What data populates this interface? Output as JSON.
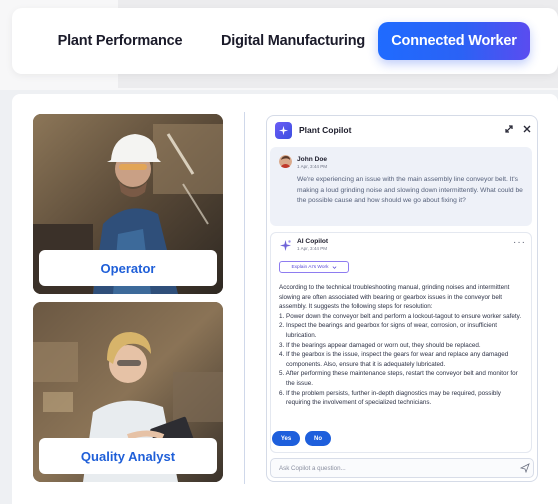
{
  "tabs": [
    {
      "label": "Plant Performance"
    },
    {
      "label": "Digital Manufacturing"
    },
    {
      "label": "Connected Worker",
      "active": true
    }
  ],
  "cards": [
    {
      "label": "Operator"
    },
    {
      "label": "Quality Analyst"
    }
  ],
  "copilot": {
    "title": "Plant Copilot",
    "user": {
      "name": "John Doe",
      "time": "1 Apr, 3:44 PM",
      "message": "We're experiencing an issue with the main assembly line conveyor belt. It's making a loud grinding noise and slowing down intermittently. What could be the possible cause and how should we go about fixing it?"
    },
    "ai": {
      "name": "AI Copilot",
      "time": "1 Apr, 3:44 PM",
      "more": "···",
      "explain_label": "Explain AI's Work",
      "intro": "According to the technical troubleshooting manual, grinding noises and intermittent slowing are often associated with bearing or gearbox issues in the conveyor belt assembly. It suggests the following steps for resolution:",
      "steps": [
        "1. Power down the conveyor belt and perform a lockout-tagout to ensure worker safety.",
        "2. Inspect the bearings and gearbox for signs of wear, corrosion, or insufficient lubrication.",
        "3. If the bearings appear damaged or worn out, they should be replaced.",
        "4. If the gearbox is the issue, inspect the gears for wear and replace any damaged components. Also, ensure that it is adequately lubricated.",
        "5. After performing these maintenance steps, restart the conveyor belt and monitor for the issue.",
        "6. If the problem persists, further in-depth diagnostics may be required, possibly requiring the involvement of specialized technicians."
      ]
    },
    "yes_label": "Yes",
    "no_label": "No",
    "input_placeholder": "Ask Copilot a question..."
  },
  "colors": {
    "accent": "#1f6bff",
    "label_blue": "#1f5fd8",
    "pill_blue": "#1e5fdc"
  }
}
